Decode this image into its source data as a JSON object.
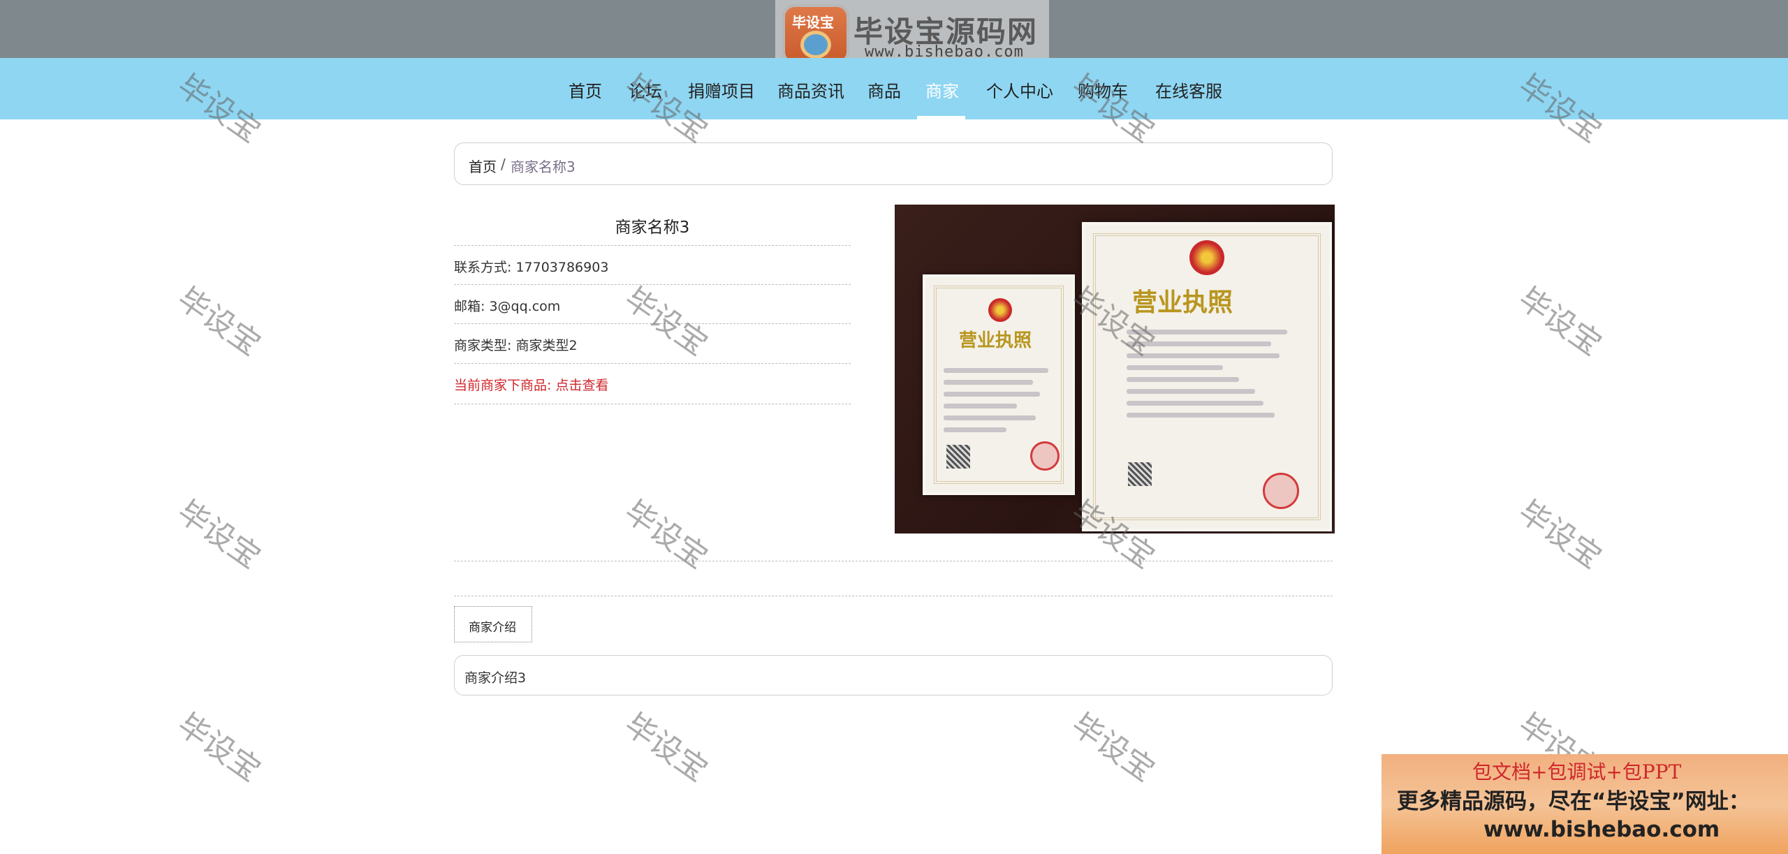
{
  "header": {
    "logo_title": "毕设宝源码网",
    "logo_url": "www.bishebao.com",
    "logo_emblem_text": "毕设宝"
  },
  "nav": {
    "items": [
      {
        "label": "首页",
        "active": false
      },
      {
        "label": "论坛",
        "active": false
      },
      {
        "label": "捐赠项目",
        "active": false
      },
      {
        "label": "商品资讯",
        "active": false
      },
      {
        "label": "商品",
        "active": false
      },
      {
        "label": "商家",
        "active": true
      },
      {
        "label": "个人中心",
        "active": false
      },
      {
        "label": "购物车",
        "active": false
      },
      {
        "label": "在线客服",
        "active": false
      }
    ]
  },
  "breadcrumb": {
    "home": "首页",
    "separator": "/",
    "current": "商家名称3"
  },
  "merchant": {
    "name": "商家名称3",
    "contact": "联系方式: 17703786903",
    "email": "邮箱: 3@qq.com",
    "type": "商家类型: 商家类型2",
    "products_link": "当前商家下商品: 点击查看"
  },
  "license_image": {
    "title_small": "营业执照",
    "title_large": "营业执照"
  },
  "tabs": {
    "intro_tab": "商家介绍"
  },
  "intro": {
    "text": "商家介绍3"
  },
  "watermark": {
    "text": "毕设宝"
  },
  "ad": {
    "line1": "包文档+包调试+包PPT",
    "line2": "更多精品源码，尽在“毕设宝”网址：",
    "line3": "www.bishebao.com"
  },
  "colors": {
    "topbar": "#7f888c",
    "navbar": "#8fd6f2",
    "link_red": "#d0262b"
  }
}
